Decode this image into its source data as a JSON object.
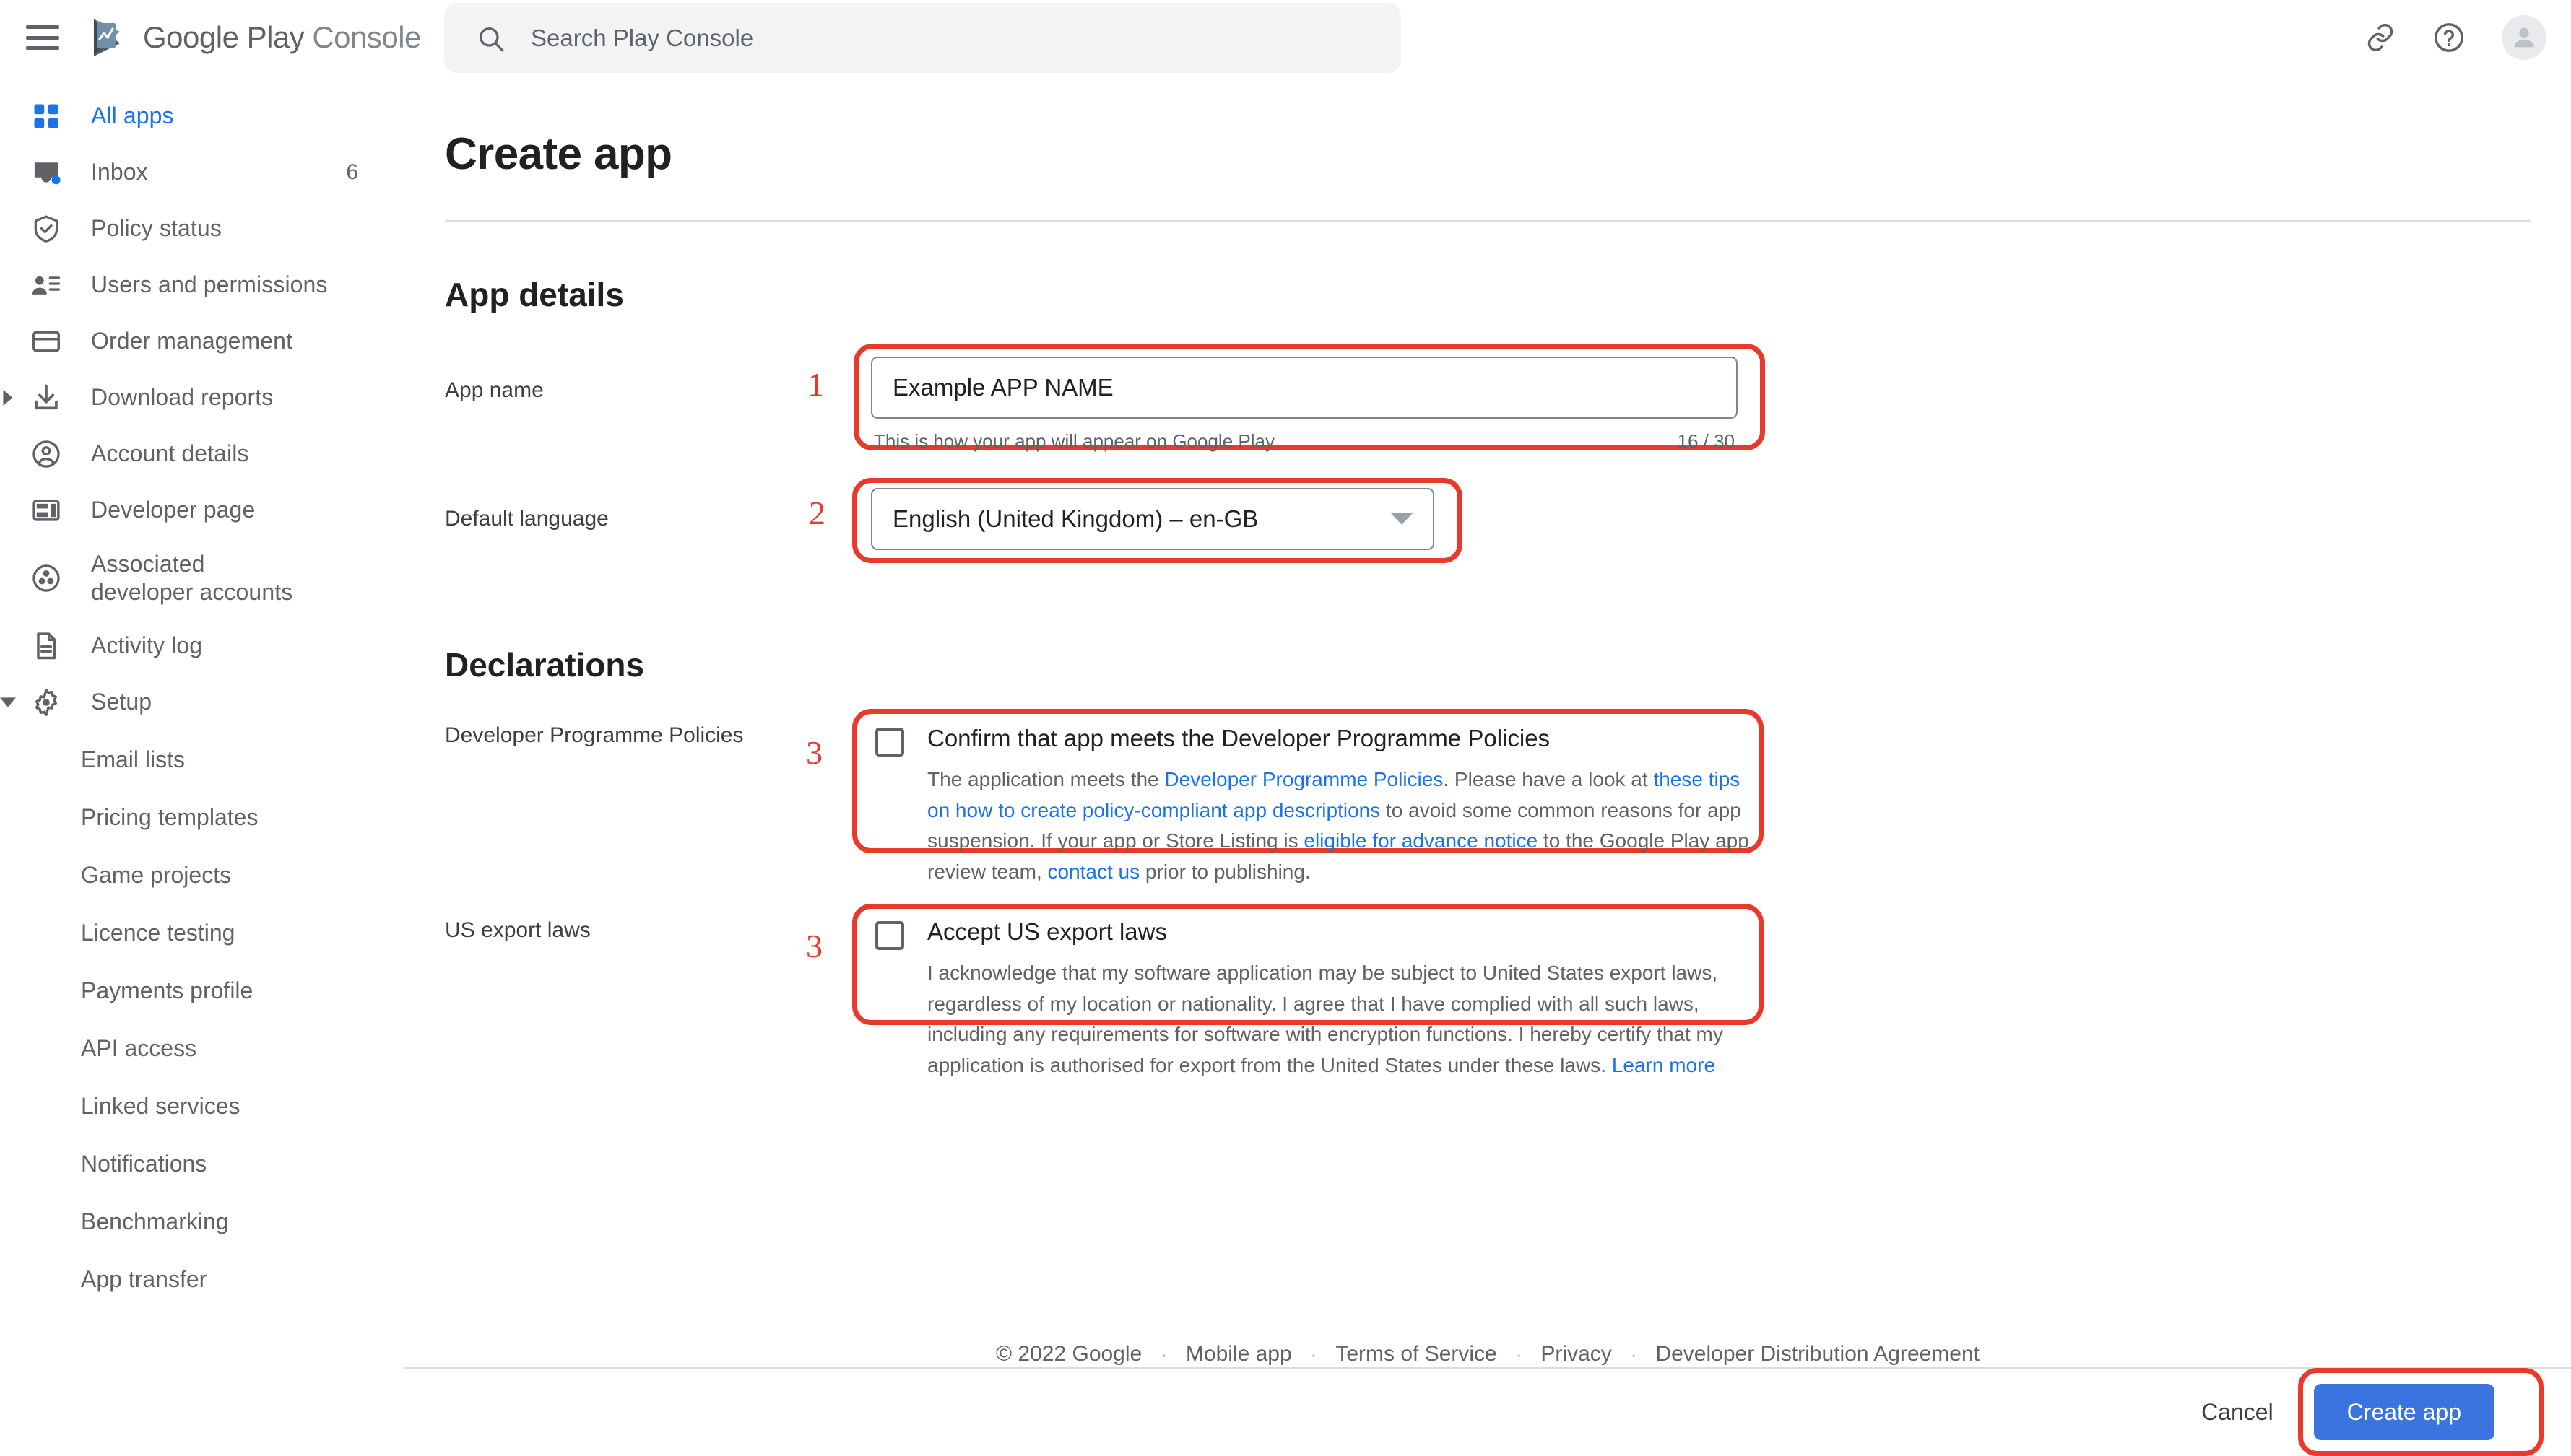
{
  "header": {
    "menu_icon": "hamburger-menu-icon",
    "brand_google": "Google Play",
    "brand_console": "Console",
    "search_placeholder": "Search Play Console",
    "link_icon": "link-icon",
    "help_icon": "help-circle-icon",
    "avatar_icon": "account-avatar-icon"
  },
  "sidebar": {
    "items": [
      {
        "label": "All apps",
        "icon": "grid-apps-icon",
        "active": true,
        "badge": ""
      },
      {
        "label": "Inbox",
        "icon": "inbox-icon",
        "active": false,
        "badge": "6"
      },
      {
        "label": "Policy status",
        "icon": "shield-check-icon",
        "active": false,
        "badge": ""
      },
      {
        "label": "Users and permissions",
        "icon": "users-permissions-icon",
        "active": false,
        "badge": ""
      },
      {
        "label": "Order management",
        "icon": "credit-card-icon",
        "active": false,
        "badge": ""
      },
      {
        "label": "Download reports",
        "icon": "download-icon",
        "active": false,
        "badge": "",
        "expander": "chevron-right-icon"
      },
      {
        "label": "Account details",
        "icon": "account-circle-icon",
        "active": false,
        "badge": ""
      },
      {
        "label": "Developer page",
        "icon": "developer-page-icon",
        "active": false,
        "badge": ""
      },
      {
        "label": "Associated developer accounts",
        "icon": "associated-accounts-icon",
        "active": false,
        "badge": ""
      },
      {
        "label": "Activity log",
        "icon": "document-icon",
        "active": false,
        "badge": ""
      },
      {
        "label": "Setup",
        "icon": "gear-icon",
        "active": false,
        "badge": "",
        "expander": "chevron-down-icon"
      }
    ],
    "sub_items": [
      {
        "label": "Email lists"
      },
      {
        "label": "Pricing templates"
      },
      {
        "label": "Game projects"
      },
      {
        "label": "Licence testing"
      },
      {
        "label": "Payments profile"
      },
      {
        "label": "API access"
      },
      {
        "label": "Linked services"
      },
      {
        "label": "Notifications"
      },
      {
        "label": "Benchmarking"
      },
      {
        "label": "App transfer"
      }
    ]
  },
  "main": {
    "page_title": "Create app",
    "app_details": {
      "section_title": "App details",
      "app_name_label": "App name",
      "app_name_value": "Example APP NAME",
      "app_name_help": "This is how your app will appear on Google Play",
      "app_name_counter": "16 / 30",
      "default_language_label": "Default language",
      "default_language_value": "English (United Kingdom) – en-GB"
    },
    "declarations": {
      "section_title": "Declarations",
      "policies_label": "Developer Programme Policies",
      "policies_check_title": "Confirm that app meets the Developer Programme Policies",
      "policies_body_1": "The application meets the ",
      "policies_link_1": "Developer Programme Policies",
      "policies_body_2": ". Please have a look at ",
      "policies_link_2": "these tips on how to create policy-compliant app descriptions",
      "policies_body_3": " to avoid some common reasons for app suspension. If your app or Store Listing is ",
      "policies_link_3": "eligible for advance notice",
      "policies_body_4": " to the Google Play app review team, ",
      "policies_link_4": "contact us",
      "policies_body_5": " prior to publishing.",
      "export_label": "US export laws",
      "export_check_title": "Accept US export laws",
      "export_body_1": "I acknowledge that my software application may be subject to United States export laws, regardless of my location or nationality. I agree that I have complied with all such laws, including any requirements for software with encryption functions. I hereby certify that my application is authorised for export from the United States under these laws. ",
      "export_link": "Learn more"
    }
  },
  "footer": {
    "copyright": "© 2022 Google",
    "links": [
      "Mobile app",
      "Terms of Service",
      "Privacy",
      "Developer Distribution Agreement"
    ],
    "separator": "·"
  },
  "actionbar": {
    "cancel_label": "Cancel",
    "create_label": "Create app"
  },
  "annotations": {
    "marker_1": "1",
    "marker_2": "2",
    "marker_3a": "3",
    "marker_3b": "3",
    "color": "#E8392B"
  },
  "colors": {
    "accent_blue": "#1a73e8",
    "primary_button": "#3b73df",
    "text": "#3c4043",
    "muted_text": "#5f6368",
    "annotation": "#E8392B"
  }
}
